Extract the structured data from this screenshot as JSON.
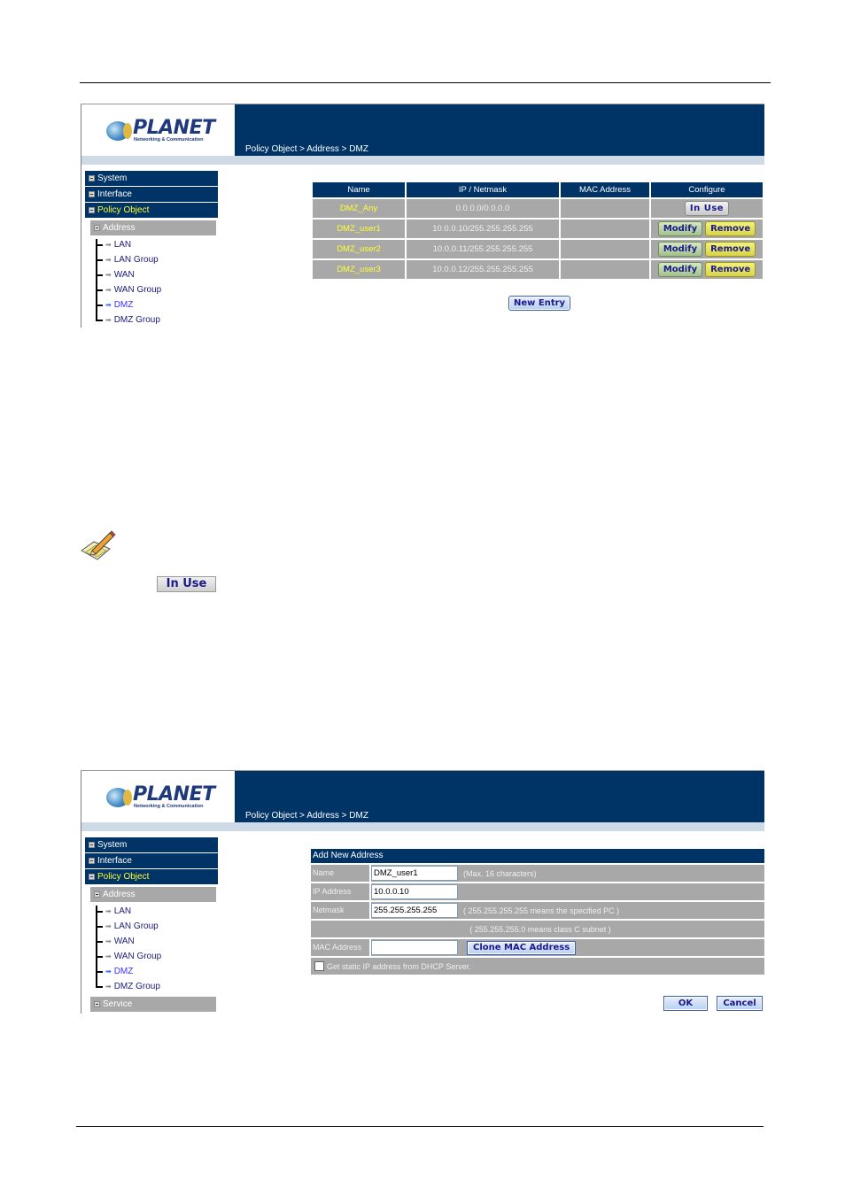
{
  "screen1": {
    "logo": {
      "brand": "PLANET",
      "tagline": "Networking & Communication"
    },
    "breadcrumb": "Policy Object > Address > DMZ",
    "sidebar": {
      "main_items": [
        {
          "label": "System"
        },
        {
          "label": "Interface"
        },
        {
          "label": "Policy Object",
          "active": true
        }
      ],
      "sub_section": "Address",
      "tree_items": [
        {
          "label": "LAN"
        },
        {
          "label": "LAN Group"
        },
        {
          "label": "WAN"
        },
        {
          "label": "WAN Group"
        },
        {
          "label": "DMZ",
          "active": true
        },
        {
          "label": "DMZ Group"
        }
      ]
    },
    "table": {
      "headers": [
        "Name",
        "IP / Netmask",
        "MAC Address",
        "Configure"
      ],
      "rows": [
        {
          "name": "DMZ_Any",
          "ip": "0.0.0.0/0.0.0.0",
          "mac": "",
          "actions": [
            "In Use"
          ]
        },
        {
          "name": "DMZ_user1",
          "ip": "10.0.0.10/255.255.255.255",
          "mac": "",
          "actions": [
            "Modify",
            "Remove"
          ]
        },
        {
          "name": "DMZ_user2",
          "ip": "10.0.0.11/255.255.255.255",
          "mac": "",
          "actions": [
            "Modify",
            "Remove"
          ]
        },
        {
          "name": "DMZ_user3",
          "ip": "10.0.0.12/255.255.255.255",
          "mac": "",
          "actions": [
            "Modify",
            "Remove"
          ]
        }
      ]
    },
    "new_entry_label": "New Entry"
  },
  "note": {
    "icon": "note-pencil-icon",
    "inline_button": "In Use"
  },
  "screen2": {
    "logo": {
      "brand": "PLANET",
      "tagline": "Networking & Communication"
    },
    "breadcrumb": "Policy Object > Address > DMZ",
    "sidebar": {
      "main_items": [
        {
          "label": "System"
        },
        {
          "label": "Interface"
        },
        {
          "label": "Policy Object",
          "active": true
        }
      ],
      "sub_section": "Address",
      "tree_items": [
        {
          "label": "LAN"
        },
        {
          "label": "LAN Group"
        },
        {
          "label": "WAN"
        },
        {
          "label": "WAN Group"
        },
        {
          "label": "DMZ",
          "active": true
        },
        {
          "label": "DMZ Group"
        }
      ],
      "next_section": "Service"
    },
    "form": {
      "title": "Add New Address",
      "name_label": "Name",
      "name_value": "DMZ_user1",
      "name_hint": "(Max. 16 characters)",
      "ip_label": "IP Address",
      "ip_value": "10.0.0.10",
      "netmask_label": "Netmask",
      "netmask_value": "255.255.255.255",
      "netmask_hint": "( 255.255.255.255 means the specified PC )",
      "netmask_hint2": "( 255.255.255.0 means class C subnet )",
      "mac_label": "MAC Address",
      "mac_value": "",
      "clone_mac_label": "Clone MAC Address",
      "dhcp_label": "Get static IP address from DHCP Server.",
      "dhcp_checked": false,
      "ok_label": "OK",
      "cancel_label": "Cancel"
    }
  },
  "colors": {
    "header_navy": "#003366",
    "row_gray": "#a8a8a8",
    "name_yellow": "#ffff33",
    "subbar": "#cedbe6"
  }
}
